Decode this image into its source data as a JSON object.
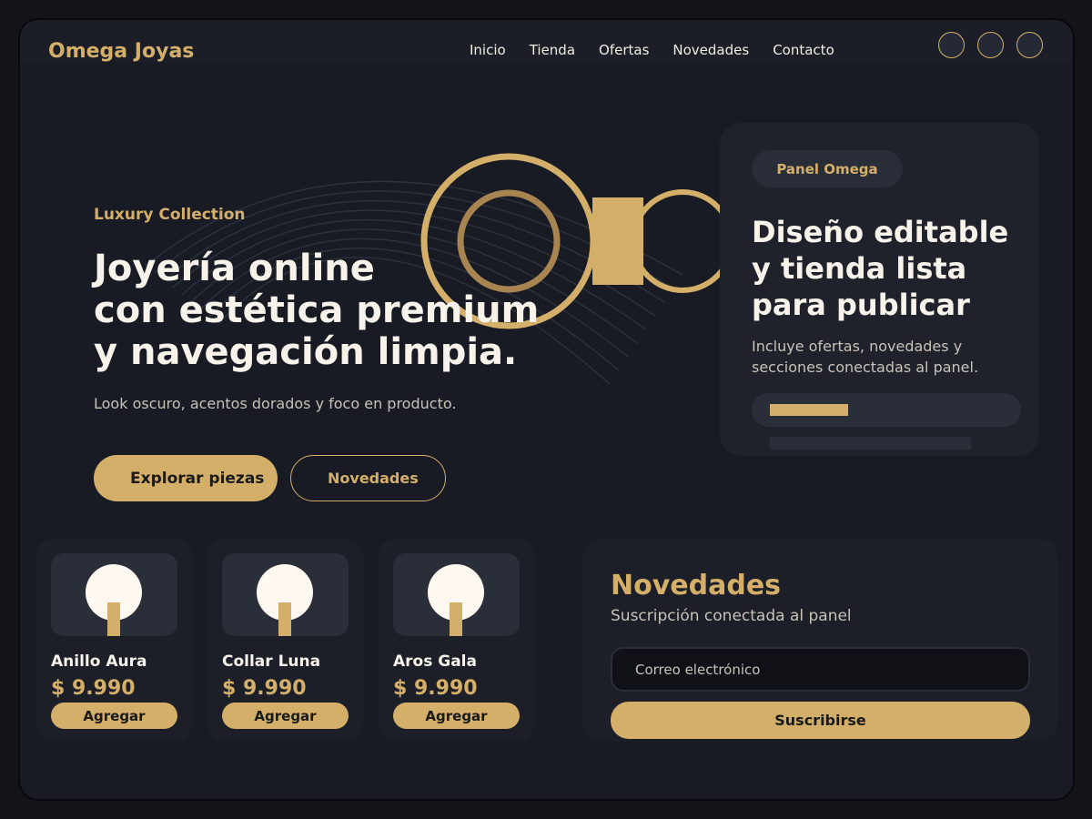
{
  "brand": "Omega Joyas",
  "nav": {
    "items": [
      {
        "label": "Inicio"
      },
      {
        "label": "Tienda"
      },
      {
        "label": "Ofertas"
      },
      {
        "label": "Novedades"
      },
      {
        "label": "Contacto"
      }
    ]
  },
  "hero": {
    "eyebrow": "Luxury Collection",
    "title_lines": [
      "Joyería online",
      "con estética premium",
      "y navegación limpia."
    ],
    "subtitle": "Look oscuro, acentos dorados y foco en producto.",
    "primary_button": "Explorar piezas",
    "secondary_button": "Novedades"
  },
  "panel": {
    "badge": "Panel Omega",
    "title_lines": [
      "Diseño editable",
      "y tienda lista",
      "para publicar"
    ],
    "description": "Incluye ofertas, novedades y secciones conectadas al panel.",
    "progress": 0.29
  },
  "products": [
    {
      "name": "Anillo Aura",
      "price": "$ 9.990",
      "button": "Agregar"
    },
    {
      "name": "Collar Luna",
      "price": "$ 9.990",
      "button": "Agregar"
    },
    {
      "name": "Aros Gala",
      "price": "$ 9.990",
      "button": "Agregar"
    }
  ],
  "newsletter": {
    "title": "Novedades",
    "subtitle": "Suscripción conectada al panel",
    "email_placeholder": "Correo electrónico",
    "button": "Suscribirse"
  },
  "colors": {
    "gold": "#d4af6a",
    "background": "#181b23",
    "text": "#f7f2ea"
  }
}
